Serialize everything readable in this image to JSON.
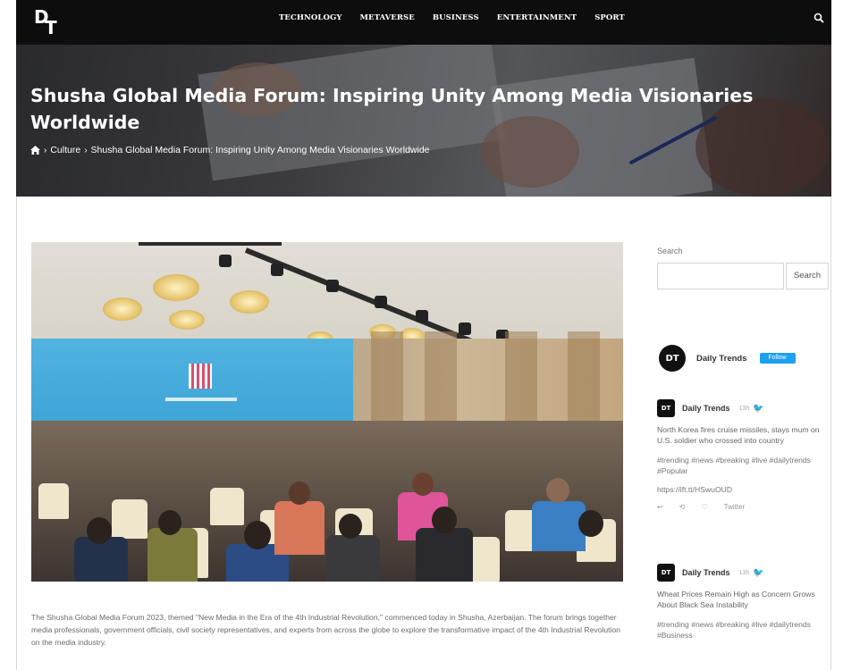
{
  "nav": {
    "logo_main": "D",
    "logo_sub": "T",
    "links": [
      "TECHNOLOGY",
      "METAVERSE",
      "BUSINESS",
      "ENTERTAINMENT",
      "SPORT"
    ]
  },
  "hero": {
    "title": "Shusha Global Media Forum: Inspiring Unity Among Media Visionaries Worldwide",
    "breadcrumb": {
      "home_icon": "home-icon",
      "section": "Culture",
      "current": "Shusha Global Media Forum: Inspiring Unity Among Media Visionaries Worldwide"
    }
  },
  "article": {
    "image_icon": "conference-photo",
    "caption": "The Shusha Global Media Forum 2023, themed \"New Media in the Era of the 4th Industrial Revolution,\" commenced today in Shusha, Azerbaijan. The forum brings together media professionals, government officials, civil society representatives, and experts from across the globe to explore the transformative impact of the 4th Industrial Revolution on the media industry."
  },
  "sidebar": {
    "search_label": "Search",
    "search_placeholder": "",
    "search_button": "Search",
    "twitter": {
      "account_name": "Daily Trends",
      "follow_label": "Follow",
      "tweets": [
        {
          "author": "Daily Trends",
          "ago": "13h",
          "text": "North Korea fires cruise missiles, stays mum on U.S. soldier who crossed into country",
          "tags": "#trending #news #breaking #live #dailytrends #Popular",
          "link": "https://ift.tt/HSwuOUD",
          "actions": [
            "↩",
            "⟲",
            "♡",
            "Twitter"
          ]
        },
        {
          "author": "Daily Trends",
          "ago": "13h",
          "text": "Wheat Prices Remain High as Concern Grows About Black Sea Instability",
          "tags": "#trending #news #breaking #live #dailytrends #Business"
        }
      ]
    }
  },
  "colors": {
    "nav_bg": "#0d0d0d",
    "twitter_blue": "#1da1f2"
  }
}
